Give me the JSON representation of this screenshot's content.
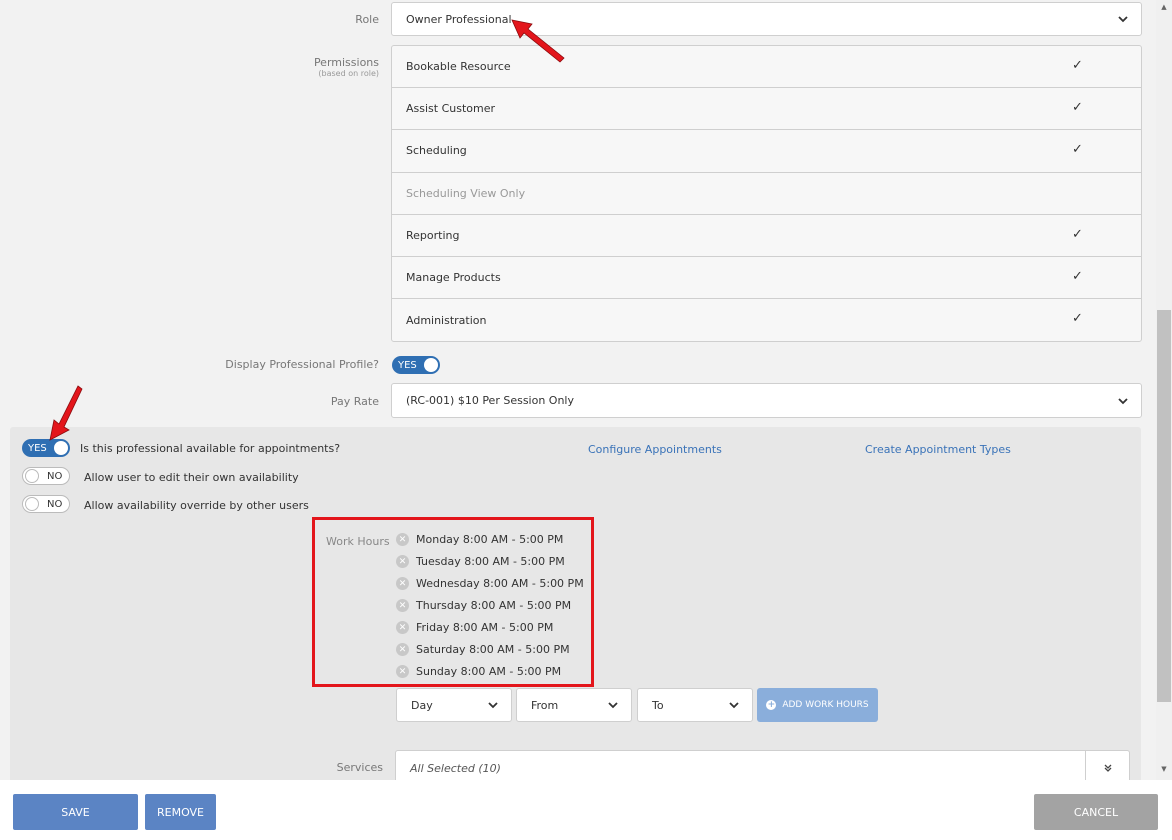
{
  "role": {
    "label": "Role",
    "value": "Owner Professional"
  },
  "permissions": {
    "label": "Permissions",
    "sublabel": "(based on role)",
    "items": [
      {
        "name": "Bookable Resource",
        "check": "✓"
      },
      {
        "name": "Assist Customer",
        "check": "✓"
      },
      {
        "name": "Scheduling",
        "check": "✓"
      },
      {
        "name": "Scheduling View Only",
        "check": ""
      },
      {
        "name": "Reporting",
        "check": "✓"
      },
      {
        "name": "Manage Products",
        "check": "✓"
      },
      {
        "name": "Administration",
        "check": "✓"
      }
    ]
  },
  "display_profile": {
    "label": "Display Professional Profile?",
    "toggle": "YES"
  },
  "pay_rate": {
    "label": "Pay Rate",
    "value": "(RC-001) $10 Per Session Only"
  },
  "availability": {
    "available_toggle": "YES",
    "available_label": "Is this professional available for appointments?",
    "edit_toggle": "NO",
    "edit_label": "Allow user to edit their own availability",
    "override_toggle": "NO",
    "override_label": "Allow availability override by other users",
    "configure_link": "Configure Appointments",
    "create_types_link": "Create Appointment Types"
  },
  "work_hours": {
    "label": "Work Hours",
    "items": [
      "Monday 8:00 AM - 5:00 PM",
      "Tuesday 8:00 AM - 5:00 PM",
      "Wednesday 8:00 AM - 5:00 PM",
      "Thursday 8:00 AM - 5:00 PM",
      "Friday 8:00 AM - 5:00 PM",
      "Saturday 8:00 AM - 5:00 PM",
      "Sunday 8:00 AM - 5:00 PM"
    ],
    "day_select": "Day",
    "from_select": "From",
    "to_select": "To",
    "add_button": "ADD WORK HOURS"
  },
  "services": {
    "label": "Services",
    "value": "All Selected (10)"
  },
  "footer": {
    "save": "SAVE",
    "remove": "REMOVE",
    "cancel": "CANCEL"
  },
  "colors": {
    "accent": "#2f6fb3",
    "button": "#5b84c4",
    "cancel": "#a3a3a3",
    "highlight": "#e3151b"
  }
}
